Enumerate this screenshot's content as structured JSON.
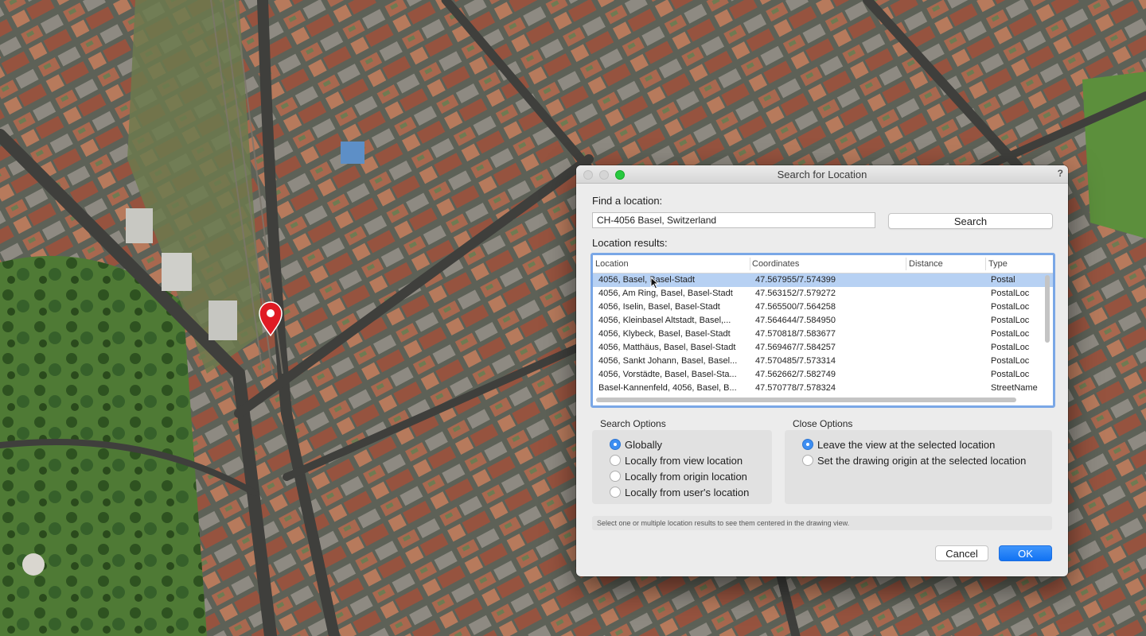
{
  "dialog": {
    "title": "Search for Location",
    "help": "?",
    "find_label": "Find a location:",
    "location_value": "CH-4056 Basel, Switzerland",
    "search_label": "Search",
    "results_label": "Location results:",
    "columns": [
      "Location",
      "Coordinates",
      "Distance",
      "Type"
    ],
    "rows": [
      {
        "location": "4056, Basel, Basel-Stadt",
        "coordinates": "47.567955/7.574399",
        "distance": "",
        "type": "Postal",
        "selected": true
      },
      {
        "location": "4056, Am Ring, Basel, Basel-Stadt",
        "coordinates": "47.563152/7.579272",
        "distance": "",
        "type": "PostalLoc"
      },
      {
        "location": "4056, Iselin, Basel, Basel-Stadt",
        "coordinates": "47.565500/7.564258",
        "distance": "",
        "type": "PostalLoc"
      },
      {
        "location": "4056, Kleinbasel Altstadt, Basel,...",
        "coordinates": "47.564644/7.584950",
        "distance": "",
        "type": "PostalLoc"
      },
      {
        "location": "4056, Klybeck, Basel, Basel-Stadt",
        "coordinates": "47.570818/7.583677",
        "distance": "",
        "type": "PostalLoc"
      },
      {
        "location": "4056, Matthäus, Basel, Basel-Stadt",
        "coordinates": "47.569467/7.584257",
        "distance": "",
        "type": "PostalLoc"
      },
      {
        "location": "4056, Sankt Johann, Basel, Basel...",
        "coordinates": "47.570485/7.573314",
        "distance": "",
        "type": "PostalLoc"
      },
      {
        "location": "4056, Vorstädte, Basel, Basel-Sta...",
        "coordinates": "47.562662/7.582749",
        "distance": "",
        "type": "PostalLoc"
      },
      {
        "location": "Basel-Kannenfeld, 4056, Basel, B...",
        "coordinates": "47.570778/7.578324",
        "distance": "",
        "type": "StreetName"
      }
    ],
    "search_options": {
      "title": "Search Options",
      "options": [
        {
          "label": "Globally",
          "checked": true
        },
        {
          "label": "Locally from view location",
          "checked": false
        },
        {
          "label": "Locally from origin location",
          "checked": false
        },
        {
          "label": "Locally from user's location",
          "checked": false
        }
      ]
    },
    "close_options": {
      "title": "Close Options",
      "options": [
        {
          "label": "Leave the view at the selected location",
          "checked": true
        },
        {
          "label": "Set the drawing origin at the selected location",
          "checked": false
        }
      ]
    },
    "hint": "Select one or multiple location results to see them centered in the drawing view.",
    "cancel_label": "Cancel",
    "ok_label": "OK"
  },
  "colors": {
    "accent": "#1172f3",
    "selection": "#b7d1f3",
    "pin": "#e01b24",
    "zoom_button": "#27c93f"
  },
  "icons": {
    "map_pin": "location-pin-icon",
    "cursor": "mouse-pointer-icon"
  }
}
